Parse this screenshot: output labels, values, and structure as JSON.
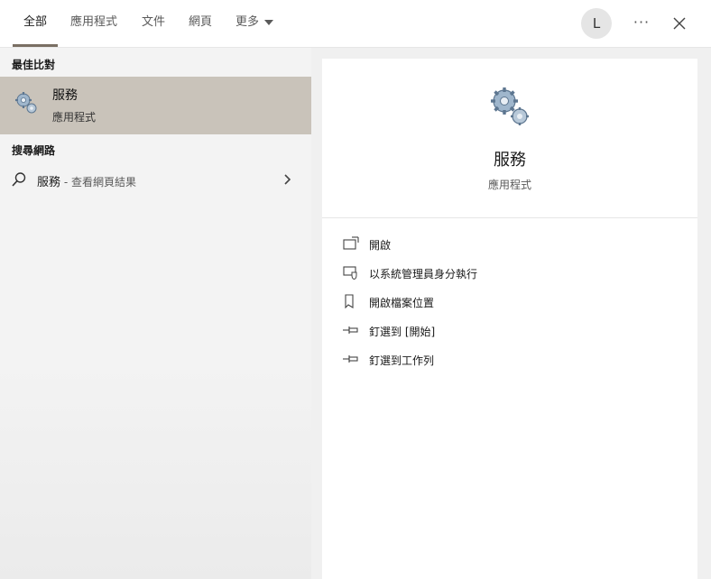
{
  "tabs": [
    {
      "label": "全部",
      "active": true
    },
    {
      "label": "應用程式"
    },
    {
      "label": "文件"
    },
    {
      "label": "網頁"
    },
    {
      "label": "更多"
    }
  ],
  "header": {
    "avatar_initial": "L",
    "more_label": "···"
  },
  "left": {
    "best_match_header": "最佳比對",
    "best_match": {
      "name": "服務",
      "type": "應用程式",
      "icon": "services-gear-icon"
    },
    "web_header": "搜尋網路",
    "web_result": {
      "query": "服務",
      "suffix": " - 查看網頁結果"
    }
  },
  "detail": {
    "name": "服務",
    "type": "應用程式",
    "actions": [
      {
        "label": "開啟",
        "icon": "open-icon"
      },
      {
        "label": "以系統管理員身分執行",
        "icon": "run-as-admin-icon"
      },
      {
        "label": "開啟檔案位置",
        "icon": "file-location-icon"
      },
      {
        "label": "釘選到 [開始]",
        "icon": "pin-icon"
      },
      {
        "label": "釘選到工作列",
        "icon": "pin-icon"
      }
    ]
  },
  "colors": {
    "accent": "#7a6f63",
    "selection": "#c9c3ba",
    "pane_bg": "#f3f3f3"
  }
}
